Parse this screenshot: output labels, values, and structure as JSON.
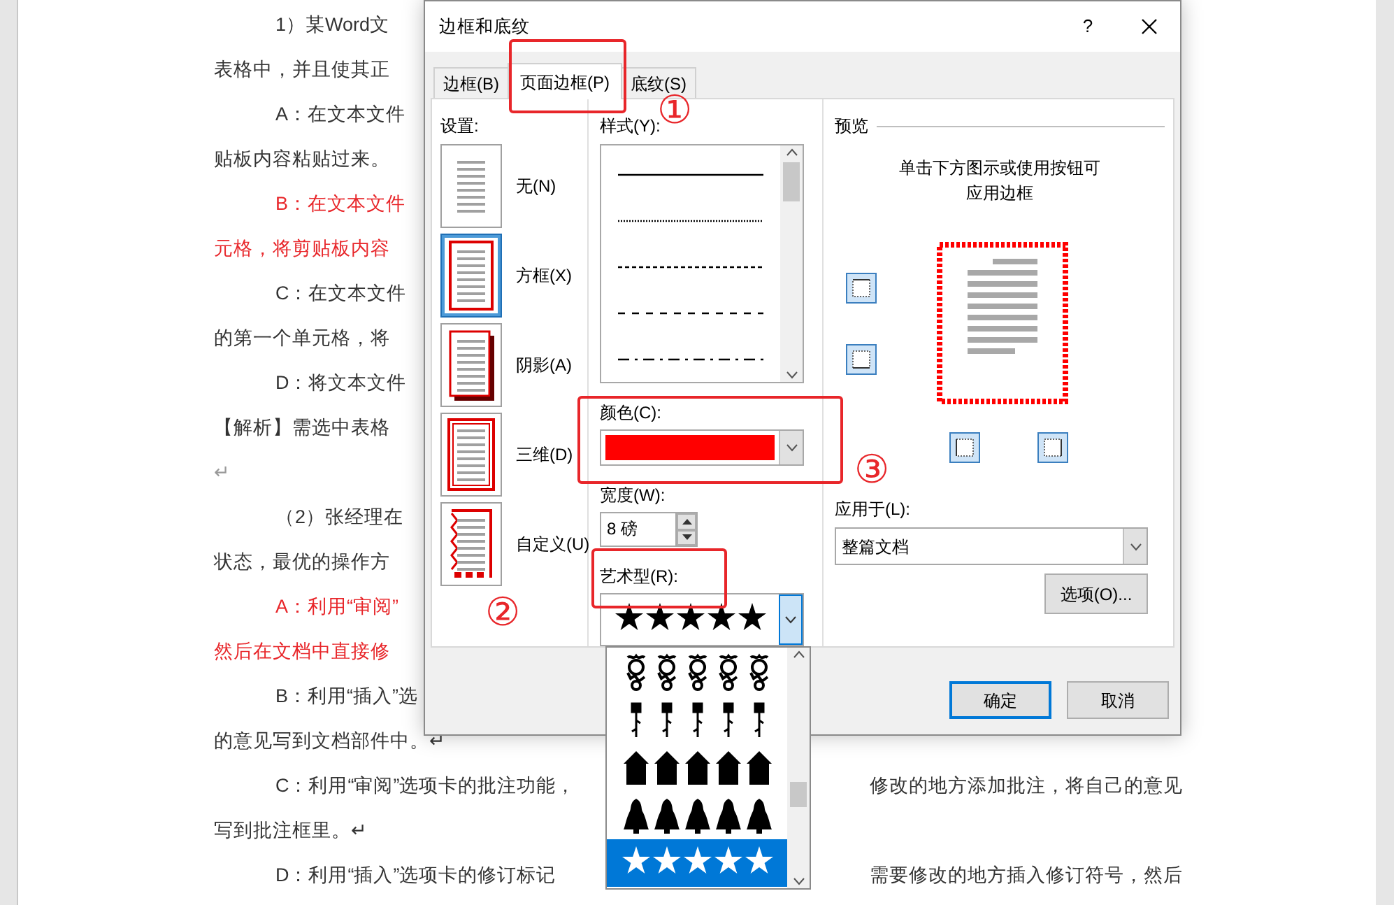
{
  "document": {
    "lines": [
      {
        "kind": "indented",
        "text": "1）某Word文",
        "color": "#333333"
      },
      {
        "kind": "plain",
        "text": "表格中，并且使其正",
        "color": "#333333"
      },
      {
        "kind": "indented",
        "text": "A：在文本文件",
        "color": "#333333"
      },
      {
        "kind": "plain",
        "text": "贴板内容粘贴过来。",
        "color": "#333333"
      },
      {
        "kind": "indented",
        "text": "B：在文本文件",
        "color": "#e8262a"
      },
      {
        "kind": "plain",
        "text": "元格，将剪贴板内容",
        "color": "#e8262a"
      },
      {
        "kind": "indented",
        "text": "C：在文本文件",
        "color": "#333333"
      },
      {
        "kind": "plain",
        "text": "的第一个单元格，将",
        "color": "#333333"
      },
      {
        "kind": "indented",
        "text": "D：将文本文件",
        "color": "#333333"
      },
      {
        "kind": "plain",
        "text": "【解析】需选中表格",
        "color": "#333333"
      },
      {
        "kind": "plain",
        "text": "↵",
        "color": "#999999"
      },
      {
        "kind": "indented",
        "text": "（2）张经理在",
        "color": "#333333"
      },
      {
        "kind": "plain",
        "text": "状态，最优的操作方",
        "color": "#333333"
      },
      {
        "kind": "indented",
        "text": "A：利用“审阅”",
        "color": "#e8262a"
      },
      {
        "kind": "plain",
        "text": "然后在文档中直接修",
        "color": "#e8262a"
      },
      {
        "kind": "indented",
        "text": "B：利用“插入”选",
        "color": "#333333"
      },
      {
        "kind": "plain",
        "text": "的意见写到文档部件中。↵",
        "color": "#333333"
      },
      {
        "kind": "indented",
        "text": "C：利用“审阅”选项卡的批注功能，",
        "text_right": "修改的地方添加批注，将自己的意见",
        "color": "#333333"
      },
      {
        "kind": "plain",
        "text": "写到批注框里。↵",
        "color": "#333333"
      },
      {
        "kind": "indented",
        "text": "D：利用“插入”选项卡的修订标记",
        "text_right": "需要修改的地方插入修订符号，然后",
        "color": "#333333"
      }
    ]
  },
  "dialog": {
    "title": "边框和底纹",
    "help": "?",
    "tabs": [
      {
        "label": "边框(B)",
        "selected": false
      },
      {
        "label": "页面边框(P)",
        "selected": true
      },
      {
        "label": "底纹(S)",
        "selected": false
      }
    ],
    "settings": {
      "label": "设置:",
      "items": [
        {
          "kind": "none",
          "label": "无(N)",
          "selected": false
        },
        {
          "kind": "box",
          "label": "方框(X)",
          "selected": true
        },
        {
          "kind": "shadow",
          "label": "阴影(A)",
          "selected": false
        },
        {
          "kind": "framed",
          "label": "三维(D)",
          "selected": false
        },
        {
          "kind": "custom",
          "label": "自定义(U)",
          "selected": false
        }
      ]
    },
    "style": {
      "label": "样式(Y):",
      "options": [
        {
          "kind": "solid"
        },
        {
          "kind": "dotted"
        },
        {
          "kind": "dashed"
        },
        {
          "kind": "long-dashed"
        },
        {
          "kind": "dash-dot"
        }
      ]
    },
    "color": {
      "label": "颜色(C):",
      "color": "#ff0000"
    },
    "width": {
      "label": "宽度(W):",
      "value": "8 磅"
    },
    "art": {
      "label": "艺术型(R):",
      "options": [
        {
          "kind": "doodle",
          "selected": false
        },
        {
          "kind": "pin",
          "selected": false
        },
        {
          "kind": "house",
          "selected": false
        },
        {
          "kind": "tree",
          "selected": false
        },
        {
          "kind": "star",
          "selected": true
        }
      ]
    },
    "preview": {
      "title": "预览",
      "hint": "单击下方图示或使用按钮可应用边框"
    },
    "apply_to": {
      "label": "应用于(L):",
      "value": "整篇文档"
    },
    "options_button": "选项(O)...",
    "buttons": [
      {
        "label": "确定",
        "default": true
      },
      {
        "label": "取消",
        "default": false
      }
    ]
  },
  "annotations": [
    {
      "label": "①"
    },
    {
      "label": "②"
    },
    {
      "label": "③"
    }
  ]
}
